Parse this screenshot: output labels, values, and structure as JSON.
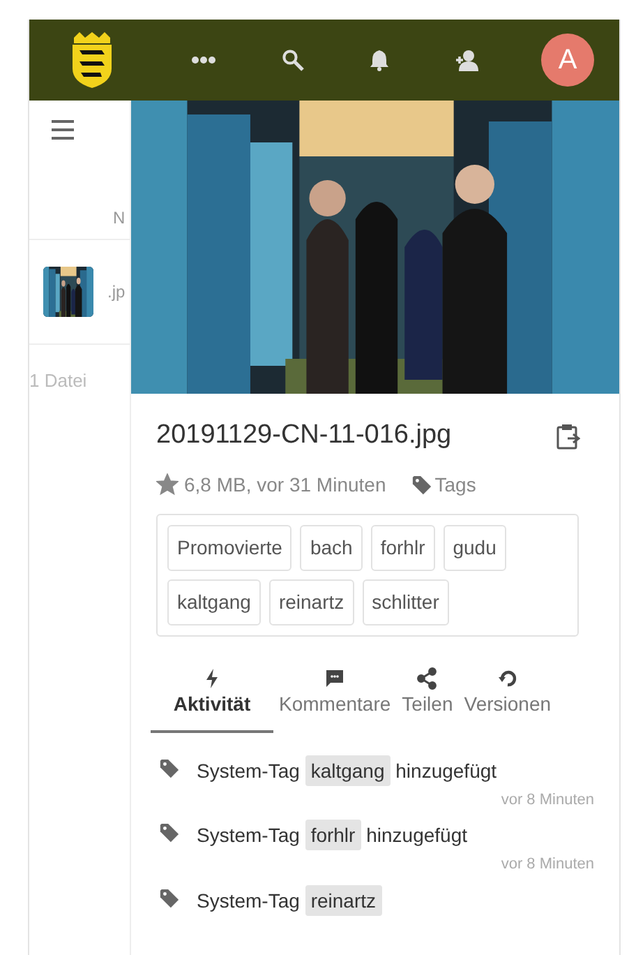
{
  "header": {
    "avatar_letter": "A"
  },
  "sidebar": {
    "fragment_1": "N",
    "fragment_2": ".jp",
    "file_count": "1 Datei"
  },
  "file": {
    "name": "20191129-CN-11-016.jpg",
    "starred": true,
    "meta": "6,8 MB, vor 31 Minuten",
    "tags_label": "Tags",
    "tags": [
      "Promovierte",
      "bach",
      "forhlr",
      "gudu",
      "kaltgang",
      "reinartz",
      "schlitter"
    ]
  },
  "tabs": [
    {
      "kind": "activity",
      "label": "Aktivität",
      "selected": true
    },
    {
      "kind": "comments",
      "label": "Kommentare",
      "selected": false
    },
    {
      "kind": "share",
      "label": "Teilen",
      "selected": false
    },
    {
      "kind": "versions",
      "label": "Versionen",
      "selected": false
    }
  ],
  "activities": [
    {
      "prefix": "System-Tag",
      "tag": "kaltgang",
      "suffix": "hinzugefügt",
      "time": "vor 8 Minuten"
    },
    {
      "prefix": "System-Tag",
      "tag": "forhlr",
      "suffix": "hinzugefügt",
      "time": "vor 8 Minuten"
    },
    {
      "prefix": "System-Tag",
      "tag": "reinartz"
    }
  ]
}
